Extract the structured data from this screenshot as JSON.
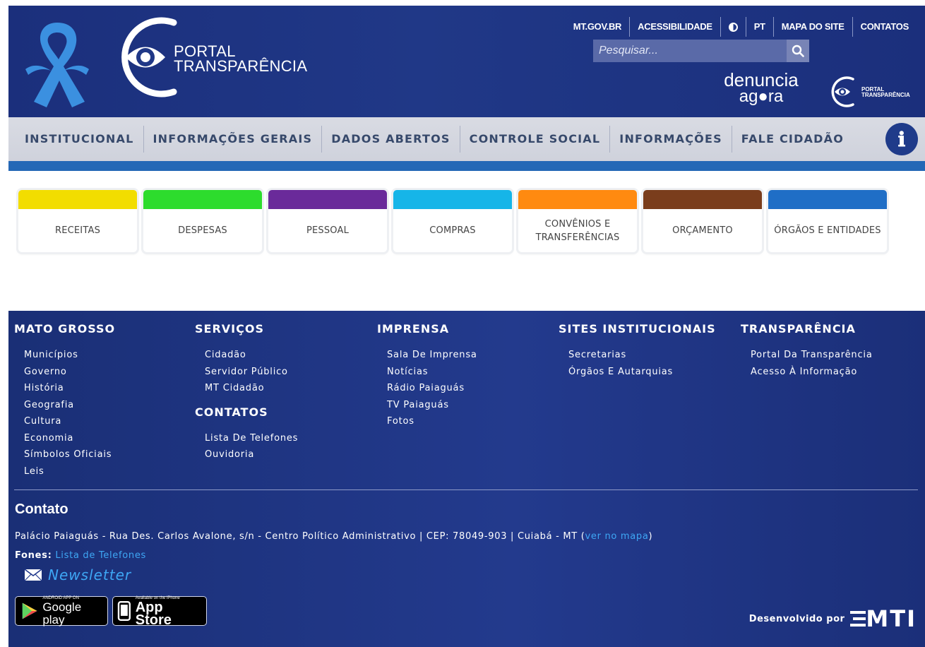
{
  "header": {
    "logo_line1": "PORTAL",
    "logo_line2": "TRANSPARÊNCIA",
    "top_links": [
      "MT.GOV.BR",
      "ACESSIBILIDADE",
      "PT",
      "MAPA DO SITE",
      "CONTATOS"
    ],
    "search_placeholder": "Pesquisar...",
    "denuncia_line1": "denuncia",
    "denuncia_line2": "ag●ra",
    "small_logo_line1": "PORTAL",
    "small_logo_line2": "TRANSPARÊNCIA",
    "icons": [
      "awareness-ribbon-icon",
      "eye-icon",
      "contrast-icon",
      "search-icon",
      "info-icon"
    ]
  },
  "nav": {
    "items": [
      "INSTITUCIONAL",
      "INFORMAÇÕES GERAIS",
      "DADOS ABERTOS",
      "CONTROLE SOCIAL",
      "INFORMAÇÕES",
      "FALE CIDADÃO"
    ]
  },
  "tiles": [
    {
      "label": "RECEITAS",
      "color": "#f2dd00"
    },
    {
      "label": "DESPESAS",
      "color": "#2ddc2d"
    },
    {
      "label": "PESSOAL",
      "color": "#6a2a9a"
    },
    {
      "label": "COMPRAS",
      "color": "#16b5e8"
    },
    {
      "label": "CONVÊNIOS E TRANSFERÊNCIAS",
      "color": "#ff8a10"
    },
    {
      "label": "ORÇAMENTO",
      "color": "#7a3d1c"
    },
    {
      "label": "ÓRGÃOS E ENTIDADES",
      "color": "#1f6ec6"
    }
  ],
  "footer": {
    "mato_grosso": {
      "title": "MATO GROSSO",
      "items": [
        "Municípios",
        "Governo",
        "História",
        "Geografia",
        "Cultura",
        "Economia",
        "Símbolos Oficiais",
        "Leis"
      ]
    },
    "servicos": {
      "title": "SERVIÇOS",
      "items": [
        "Cidadão",
        "Servidor Público",
        "MT Cidadão"
      ]
    },
    "contatos": {
      "title": "CONTATOS",
      "items": [
        "Lista De Telefones",
        "Ouvidoria"
      ]
    },
    "imprensa": {
      "title": "IMPRENSA",
      "items": [
        "Sala De Imprensa",
        "Notícias",
        "Rádio Paiaguás",
        "TV Paiaguás",
        "Fotos"
      ]
    },
    "sites": {
      "title": "SITES INSTITUCIONAIS",
      "items": [
        "Secretarias",
        "Órgãos E Autarquias"
      ]
    },
    "transparencia": {
      "title": "TRANSPARÊNCIA",
      "items": [
        "Portal Da Transparência",
        "Acesso À Informação"
      ]
    },
    "contato_title": "Contato",
    "address": "Palácio Paiaguás - Rua Des. Carlos Avalone, s/n - Centro Político Administrativo | CEP: 78049-903 | Cuiabá - MT (",
    "address_link": "ver no mapa",
    "address_end": ")",
    "fones_label": "Fones:",
    "fones_link": "Lista de Telefones",
    "newsletter": "Newsletter",
    "google_small": "ANDROID APP ON",
    "google_big": "Google play",
    "apple_small": "Available on the iPhone",
    "apple_big": "App Store",
    "dev_text": "Desenvolvido por",
    "dev_logo": "MTI",
    "link_color": "#3ea7f5"
  }
}
